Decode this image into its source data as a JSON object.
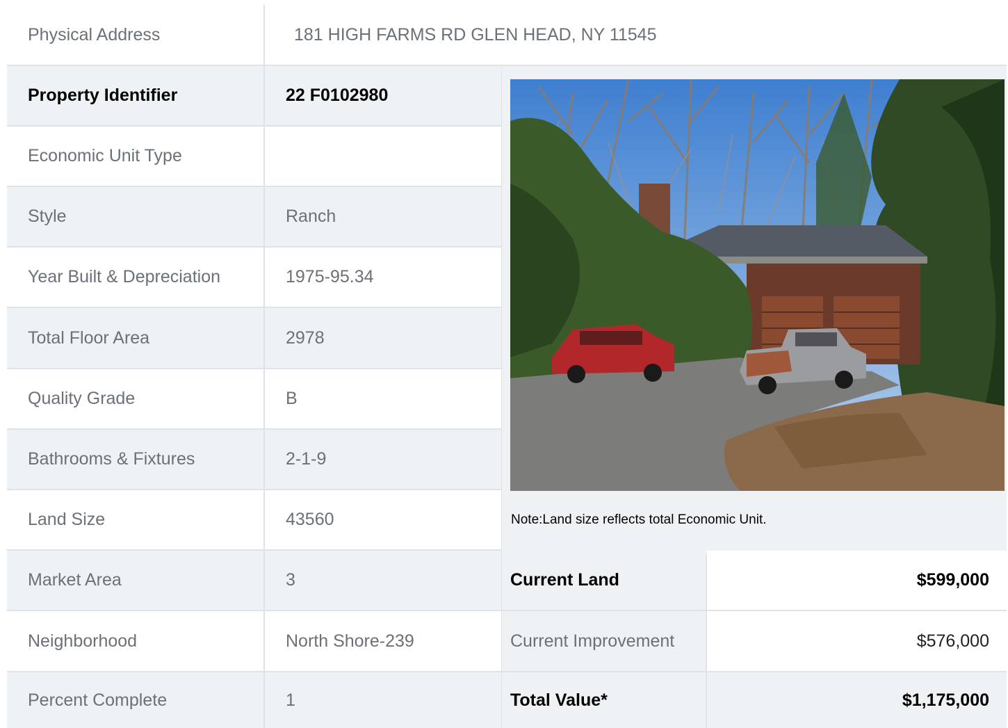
{
  "address": {
    "label": "Physical Address",
    "value": "181  HIGH FARMS RD  GLEN HEAD, NY  11545"
  },
  "property_identifier": {
    "label": "Property Identifier",
    "value": "22  F0102980"
  },
  "details": [
    {
      "label": "Economic Unit Type",
      "value": ""
    },
    {
      "label": "Style",
      "value": "Ranch"
    },
    {
      "label": "Year Built & Depreciation",
      "value": "1975-95.34"
    },
    {
      "label": "Total Floor Area",
      "value": "2978"
    },
    {
      "label": "Quality Grade",
      "value": "B"
    },
    {
      "label": "Bathrooms & Fixtures",
      "value": "2-1-9"
    },
    {
      "label": "Land Size",
      "value": "43560"
    },
    {
      "label": "Market Area",
      "value": "3"
    },
    {
      "label": "Neighborhood",
      "value": "North Shore-239"
    },
    {
      "label": "Percent Complete",
      "value": "1"
    }
  ],
  "note": "Note:Land size reflects total Economic Unit.",
  "values": {
    "current_land_label": "Current Land",
    "current_land": "$599,000",
    "current_improvement_label": "Current Improvement",
    "current_improvement": "$576,000",
    "total_label": "Total Value*",
    "total": "$1,175,000"
  }
}
